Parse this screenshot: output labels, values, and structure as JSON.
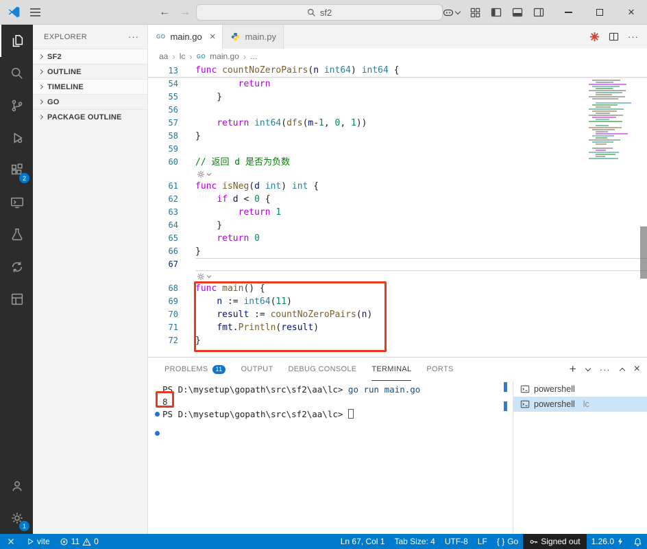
{
  "window": {
    "search": "sf2"
  },
  "activity_bar": {
    "extensions_badge": "2",
    "settings_badge": "1"
  },
  "sidebar": {
    "title": "EXPLORER",
    "more": "···",
    "sections": [
      {
        "label": "SF2"
      },
      {
        "label": "OUTLINE"
      },
      {
        "label": "TIMELINE"
      },
      {
        "label": "GO"
      },
      {
        "label": "PACKAGE OUTLINE"
      }
    ]
  },
  "icons": {
    "go_file": "GO"
  },
  "tabs": [
    {
      "label": "main.go"
    },
    {
      "label": "main.py"
    }
  ],
  "breadcrumb": [
    "aa",
    "lc",
    "main.go",
    "..."
  ],
  "editor": {
    "cursor_line": "67",
    "sticky": {
      "num": "13",
      "tokens": [
        {
          "c": "kw",
          "t": "func"
        },
        {
          "c": "pl",
          "t": " "
        },
        {
          "c": "fn",
          "t": "countNoZeroPairs"
        },
        {
          "c": "pl",
          "t": "("
        },
        {
          "c": "var",
          "t": "n"
        },
        {
          "c": "pl",
          "t": " "
        },
        {
          "c": "ty",
          "t": "int64"
        },
        {
          "c": "pl",
          "t": ") "
        },
        {
          "c": "ty",
          "t": "int64"
        },
        {
          "c": "pl",
          "t": " {"
        }
      ]
    },
    "rows": [
      {
        "type": "code",
        "num": "54",
        "tokens": [
          {
            "c": "pl",
            "t": "        "
          },
          {
            "c": "kw",
            "t": "return"
          }
        ]
      },
      {
        "type": "code",
        "num": "55",
        "tokens": [
          {
            "c": "pl",
            "t": "    }"
          }
        ]
      },
      {
        "type": "code",
        "num": "56",
        "tokens": []
      },
      {
        "type": "code",
        "num": "57",
        "tokens": [
          {
            "c": "pl",
            "t": "    "
          },
          {
            "c": "kw",
            "t": "return"
          },
          {
            "c": "pl",
            "t": " "
          },
          {
            "c": "ty",
            "t": "int64"
          },
          {
            "c": "pl",
            "t": "("
          },
          {
            "c": "fn",
            "t": "dfs"
          },
          {
            "c": "pl",
            "t": "("
          },
          {
            "c": "var",
            "t": "m"
          },
          {
            "c": "pl",
            "t": "-"
          },
          {
            "c": "num",
            "t": "1"
          },
          {
            "c": "pl",
            "t": ", "
          },
          {
            "c": "num",
            "t": "0"
          },
          {
            "c": "pl",
            "t": ", "
          },
          {
            "c": "num",
            "t": "1"
          },
          {
            "c": "pl",
            "t": "))"
          }
        ]
      },
      {
        "type": "code",
        "num": "58",
        "tokens": [
          {
            "c": "pl",
            "t": "}"
          }
        ]
      },
      {
        "type": "code",
        "num": "59",
        "tokens": []
      },
      {
        "type": "code",
        "num": "60",
        "tokens": [
          {
            "c": "cmt",
            "t": "// 返回 d 是否为负数"
          }
        ]
      },
      {
        "type": "lens"
      },
      {
        "type": "code",
        "num": "61",
        "tokens": [
          {
            "c": "kw",
            "t": "func"
          },
          {
            "c": "pl",
            "t": " "
          },
          {
            "c": "fn",
            "t": "isNeg"
          },
          {
            "c": "pl",
            "t": "("
          },
          {
            "c": "var",
            "t": "d"
          },
          {
            "c": "pl",
            "t": " "
          },
          {
            "c": "ty",
            "t": "int"
          },
          {
            "c": "pl",
            "t": ") "
          },
          {
            "c": "ty",
            "t": "int"
          },
          {
            "c": "pl",
            "t": " {"
          }
        ]
      },
      {
        "type": "code",
        "num": "62",
        "tokens": [
          {
            "c": "pl",
            "t": "    "
          },
          {
            "c": "kw",
            "t": "if"
          },
          {
            "c": "pl",
            "t": " "
          },
          {
            "c": "var",
            "t": "d"
          },
          {
            "c": "pl",
            "t": " < "
          },
          {
            "c": "num",
            "t": "0"
          },
          {
            "c": "pl",
            "t": " {"
          }
        ]
      },
      {
        "type": "code",
        "num": "63",
        "tokens": [
          {
            "c": "pl",
            "t": "        "
          },
          {
            "c": "kw",
            "t": "return"
          },
          {
            "c": "pl",
            "t": " "
          },
          {
            "c": "num",
            "t": "1"
          }
        ]
      },
      {
        "type": "code",
        "num": "64",
        "tokens": [
          {
            "c": "pl",
            "t": "    }"
          }
        ]
      },
      {
        "type": "code",
        "num": "65",
        "tokens": [
          {
            "c": "pl",
            "t": "    "
          },
          {
            "c": "kw",
            "t": "return"
          },
          {
            "c": "pl",
            "t": " "
          },
          {
            "c": "num",
            "t": "0"
          }
        ]
      },
      {
        "type": "code",
        "num": "66",
        "tokens": [
          {
            "c": "pl",
            "t": "}"
          }
        ]
      },
      {
        "type": "code",
        "num": "67",
        "tokens": []
      },
      {
        "type": "lens"
      },
      {
        "type": "code",
        "num": "68",
        "tokens": [
          {
            "c": "kw",
            "t": "func"
          },
          {
            "c": "pl",
            "t": " "
          },
          {
            "c": "fn",
            "t": "main"
          },
          {
            "c": "pl",
            "t": "() {"
          }
        ]
      },
      {
        "type": "code",
        "num": "69",
        "tokens": [
          {
            "c": "pl",
            "t": "    "
          },
          {
            "c": "var",
            "t": "n"
          },
          {
            "c": "pl",
            "t": " := "
          },
          {
            "c": "ty",
            "t": "int64"
          },
          {
            "c": "pl",
            "t": "("
          },
          {
            "c": "num",
            "t": "11"
          },
          {
            "c": "pl",
            "t": ")"
          }
        ]
      },
      {
        "type": "code",
        "num": "70",
        "tokens": [
          {
            "c": "pl",
            "t": "    "
          },
          {
            "c": "var",
            "t": "result"
          },
          {
            "c": "pl",
            "t": " := "
          },
          {
            "c": "fn",
            "t": "countNoZeroPairs"
          },
          {
            "c": "pl",
            "t": "("
          },
          {
            "c": "var",
            "t": "n"
          },
          {
            "c": "pl",
            "t": ")"
          }
        ]
      },
      {
        "type": "code",
        "num": "71",
        "tokens": [
          {
            "c": "pl",
            "t": "    "
          },
          {
            "c": "var",
            "t": "fmt"
          },
          {
            "c": "pl",
            "t": "."
          },
          {
            "c": "fn",
            "t": "Println"
          },
          {
            "c": "pl",
            "t": "("
          },
          {
            "c": "var",
            "t": "result"
          },
          {
            "c": "pl",
            "t": ")"
          }
        ]
      },
      {
        "type": "code",
        "num": "72",
        "tokens": [
          {
            "c": "pl",
            "t": "}"
          }
        ]
      }
    ]
  },
  "panel": {
    "tabs": [
      {
        "label": "PROBLEMS",
        "badge": "11"
      },
      {
        "label": "OUTPUT"
      },
      {
        "label": "DEBUG CONSOLE"
      },
      {
        "label": "TERMINAL"
      },
      {
        "label": "PORTS"
      }
    ],
    "terminal": {
      "line1_prompt": "PS D:\\mysetup\\gopath\\src\\sf2\\aa\\lc>",
      "line1_command": " go run main.go",
      "line2_output": "8",
      "line3_prompt": "PS D:\\mysetup\\gopath\\src\\sf2\\aa\\lc>",
      "list": [
        {
          "label": "powershell",
          "detail": ""
        },
        {
          "label": "powershell",
          "detail": "lc"
        }
      ]
    }
  },
  "status_bar": {
    "task": "vite",
    "errors": "11",
    "warnings": "0",
    "cursor": "Ln 67, Col 1",
    "tab_size": "Tab Size: 4",
    "encoding": "UTF-8",
    "eol": "LF",
    "lang_braces": "{ }",
    "language": "Go",
    "account": "Signed out",
    "version": "1.26.0"
  },
  "colors": {
    "accent": "#007acc",
    "annotation": "#e8381f",
    "badge": "#1374c9"
  }
}
